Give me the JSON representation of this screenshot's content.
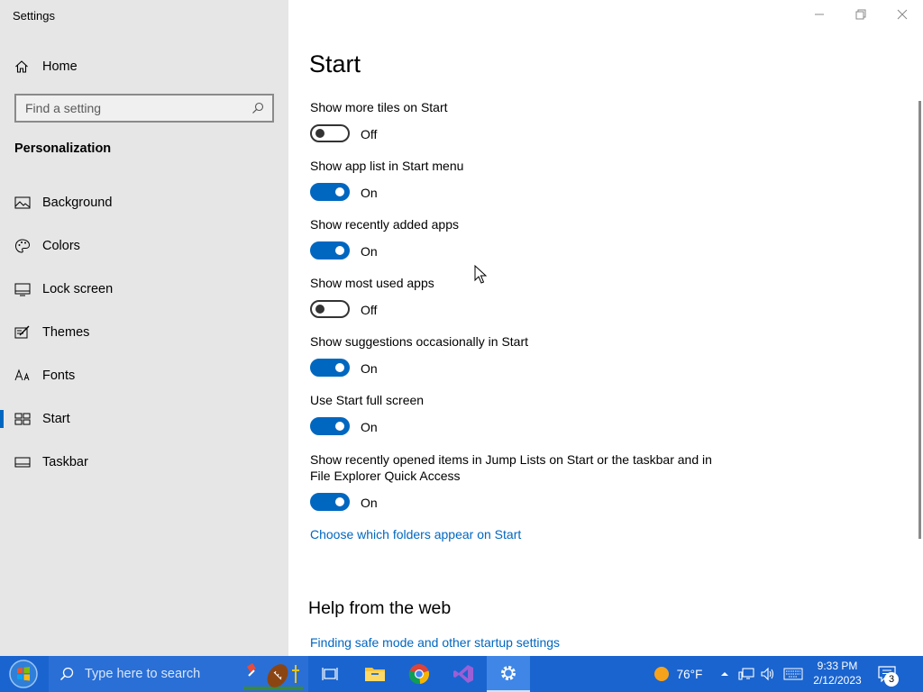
{
  "window": {
    "app_title": "Settings",
    "min_icon": "minimize-icon",
    "max_icon": "maximize-icon",
    "close_icon": "close-icon"
  },
  "sidebar": {
    "home_label": "Home",
    "search_placeholder": "Find a setting",
    "section_title": "Personalization",
    "items": [
      {
        "label": "Background",
        "icon": "picture-icon"
      },
      {
        "label": "Colors",
        "icon": "palette-icon"
      },
      {
        "label": "Lock screen",
        "icon": "lock-screen-icon"
      },
      {
        "label": "Themes",
        "icon": "brush-icon"
      },
      {
        "label": "Fonts",
        "icon": "fonts-icon"
      },
      {
        "label": "Start",
        "icon": "start-icon",
        "active": true
      },
      {
        "label": "Taskbar",
        "icon": "taskbar-icon"
      }
    ]
  },
  "main": {
    "title": "Start",
    "settings": [
      {
        "label": "Show more tiles on Start",
        "state": "Off"
      },
      {
        "label": "Show app list in Start menu",
        "state": "On"
      },
      {
        "label": "Show recently added apps",
        "state": "On"
      },
      {
        "label": "Show most used apps",
        "state": "Off"
      },
      {
        "label": "Show suggestions occasionally in Start",
        "state": "On"
      },
      {
        "label": "Use Start full screen",
        "state": "On"
      },
      {
        "label_line1": "Show recently opened items in Jump Lists on Start or the taskbar and in",
        "label_line2": "File Explorer Quick Access",
        "state": "On"
      }
    ],
    "folders_link": "Choose which folders appear on Start",
    "help_title": "Help from the web",
    "help_link": "Finding safe mode and other startup settings"
  },
  "taskbar": {
    "search_placeholder": "Type here to search",
    "weather": "76°F",
    "time": "9:33 PM",
    "date": "2/12/2023",
    "notification_count": "3"
  },
  "colors": {
    "accent": "#0067c0",
    "sidebar_bg": "#e6e6e6",
    "taskbar_bg": "#1a64cf"
  }
}
